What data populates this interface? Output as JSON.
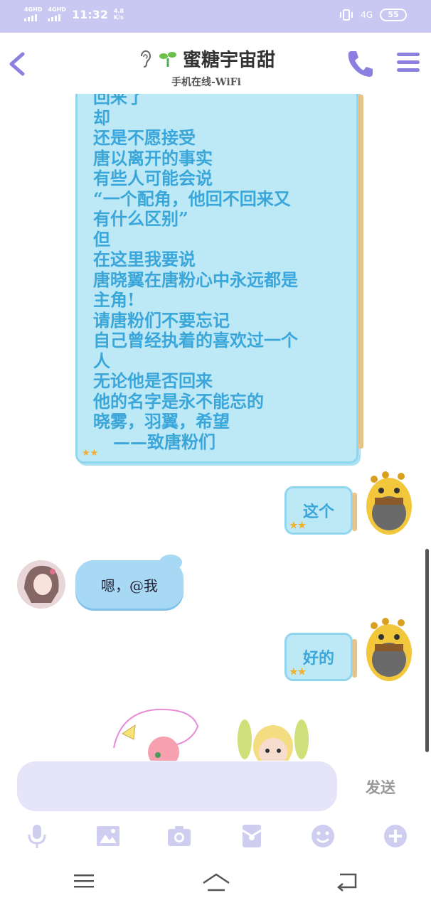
{
  "status_bar": {
    "sim1_label": "4GHD",
    "sim2_label": "4GHD",
    "time": "11:32",
    "net_speed_value": "4.8",
    "net_speed_unit": "K/s",
    "network_type": "4G",
    "battery": "55"
  },
  "header": {
    "title": "蜜糖宇宙甜",
    "subtitle": "手机在线-WiFi",
    "icon_color": "#8b7fe0"
  },
  "messages": {
    "long_post_lines": [
      "回来了",
      "却",
      "还是不愿接受",
      "唐以离开的事实",
      "有些人可能会说",
      "“一个配角，他回不回来又",
      "有什么区别”",
      "但",
      "在这里我要说",
      "唐晓翼在唐粉心中永远都是",
      "主角!",
      "请唐粉们不要忘记",
      "自己曾经执着的喜欢过一个",
      "人",
      "无论他是否回来",
      "他的名字是永不能忘的",
      "晓雾，羽翼，希望",
      "——致唐粉们"
    ],
    "me_msg_1": "这个",
    "other_msg_1": "嗯，@我",
    "me_msg_2": "好的"
  },
  "input_bar": {
    "placeholder": "",
    "send_label": "发送"
  },
  "toolbar": [
    "mic-icon",
    "image-icon",
    "camera-icon",
    "red-packet-icon",
    "emoji-icon",
    "plus-icon"
  ],
  "colors": {
    "status_bar_bg": "#c9c8f2",
    "bubble_fill": "#bde9f7",
    "bubble_text": "#3aa6d9",
    "input_bg": "#e5e4f8"
  }
}
